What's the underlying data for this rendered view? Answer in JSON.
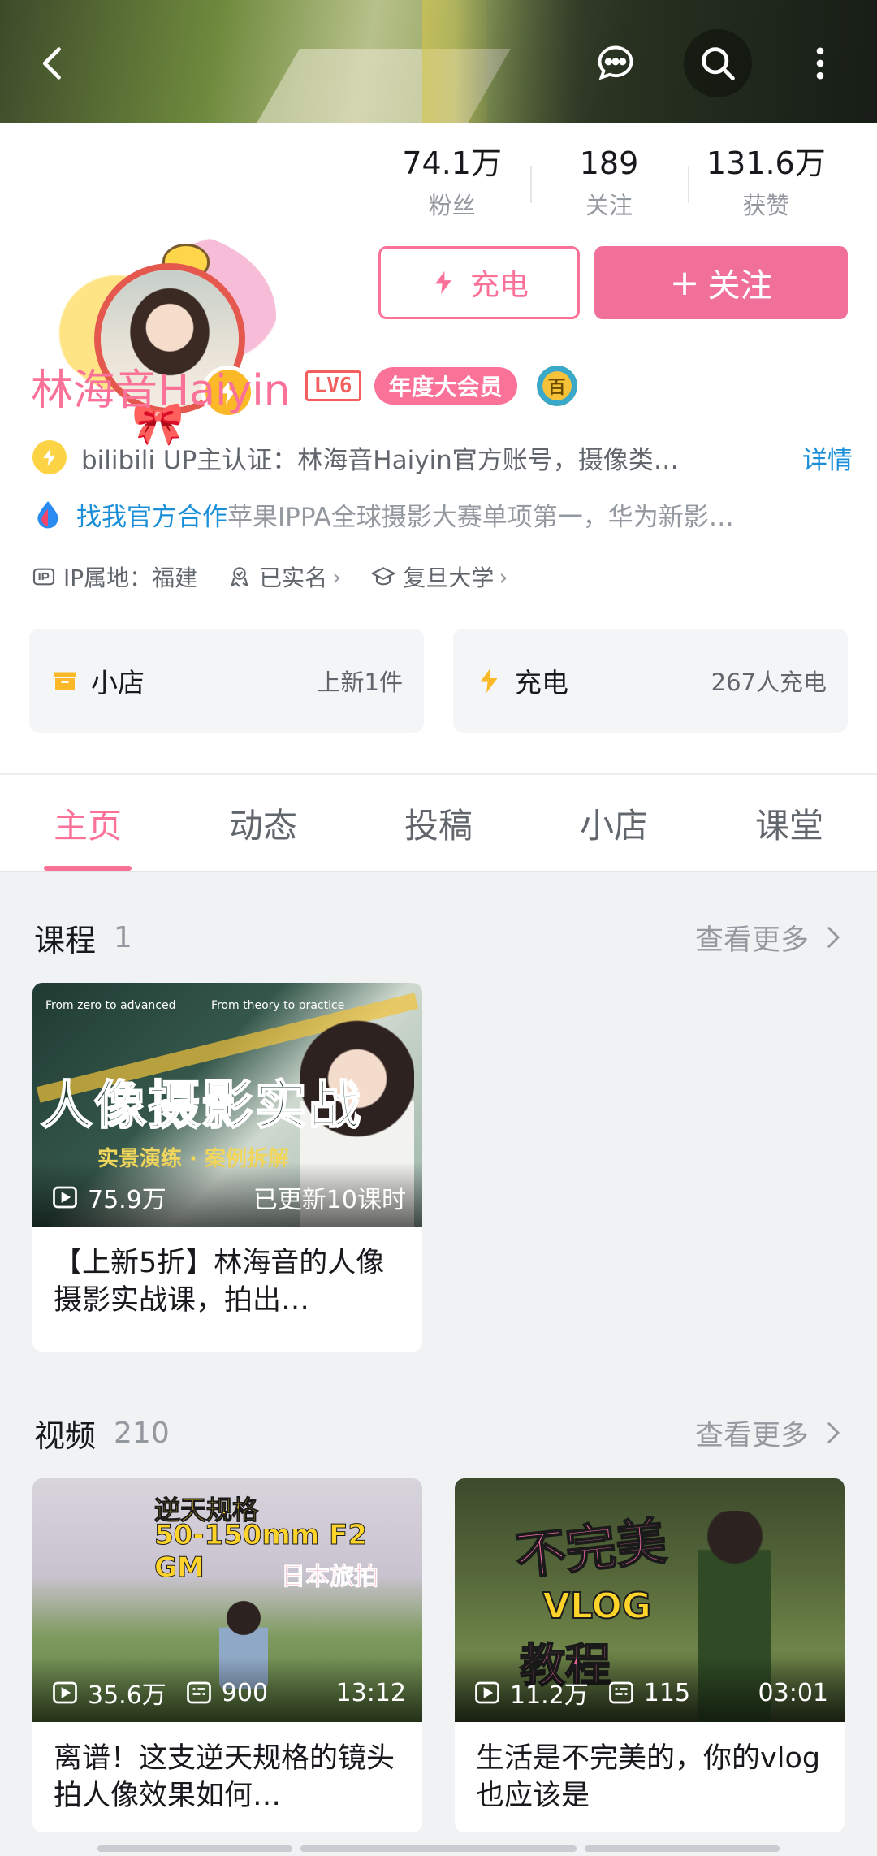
{
  "header": {
    "back_icon": "chevron-left-icon",
    "message_icon": "chat-bubble-icon",
    "search_icon": "search-icon",
    "more_icon": "more-vertical-icon"
  },
  "profile": {
    "stats": [
      {
        "value": "74.1万",
        "label": "粉丝"
      },
      {
        "value": "189",
        "label": "关注"
      },
      {
        "value": "131.6万",
        "label": "获赞"
      }
    ],
    "charge_button": "充电",
    "follow_button": "关注",
    "follow_plus": "+",
    "name": "林海音Haiyin",
    "level": "LV6",
    "vip_badge": "年度大会员",
    "medal": "百",
    "certification": "bilibili UP主认证：林海音Haiyin官方账号，摄像类…",
    "cert_more": "详情",
    "coop_link": "找我官方合作",
    "coop_text": "苹果IPPA全球摄影大赛单项第一，华为新影…",
    "ip_location": "IP属地：福建",
    "real_name": "已实名",
    "school": "复旦大学",
    "shop_card": {
      "title": "小店",
      "side": "上新1件"
    },
    "charge_card": {
      "title": "充电",
      "side": "267人充电"
    }
  },
  "tabs": [
    {
      "label": "主页",
      "active": true
    },
    {
      "label": "动态",
      "active": false
    },
    {
      "label": "投稿",
      "active": false
    },
    {
      "label": "小店",
      "active": false
    },
    {
      "label": "课堂",
      "active": false
    }
  ],
  "courses": {
    "title": "课程",
    "count": "1",
    "more": "查看更多",
    "items": [
      {
        "cover_title": "人像摄影实战",
        "cover_sub": "实景演练 · 案例拆解",
        "cover_tag_left": "From zero to advanced",
        "cover_tag_right": "From theory to practice",
        "views": "75.9万",
        "updated": "已更新10课时",
        "title": "【上新5折】林海音的人像摄影实战课，拍出…"
      }
    ]
  },
  "videos": {
    "title": "视频",
    "count": "210",
    "more": "查看更多",
    "items": [
      {
        "overlay": [
          "逆天规格",
          "50-150mm F2 GM",
          "日本旅拍"
        ],
        "views": "35.6万",
        "danmaku": "900",
        "duration": "13:12",
        "title": "离谱！这支逆天规格的镜头拍人像效果如何…"
      },
      {
        "overlay": [
          "不完美",
          "VLOG",
          "教程"
        ],
        "views": "11.2万",
        "danmaku": "115",
        "duration": "03:01",
        "title": "生活是不完美的，你的vlog也应该是"
      }
    ]
  },
  "colors": {
    "accent": "#fb7299",
    "link": "#1a8fd8",
    "charge": "#fbb927"
  }
}
